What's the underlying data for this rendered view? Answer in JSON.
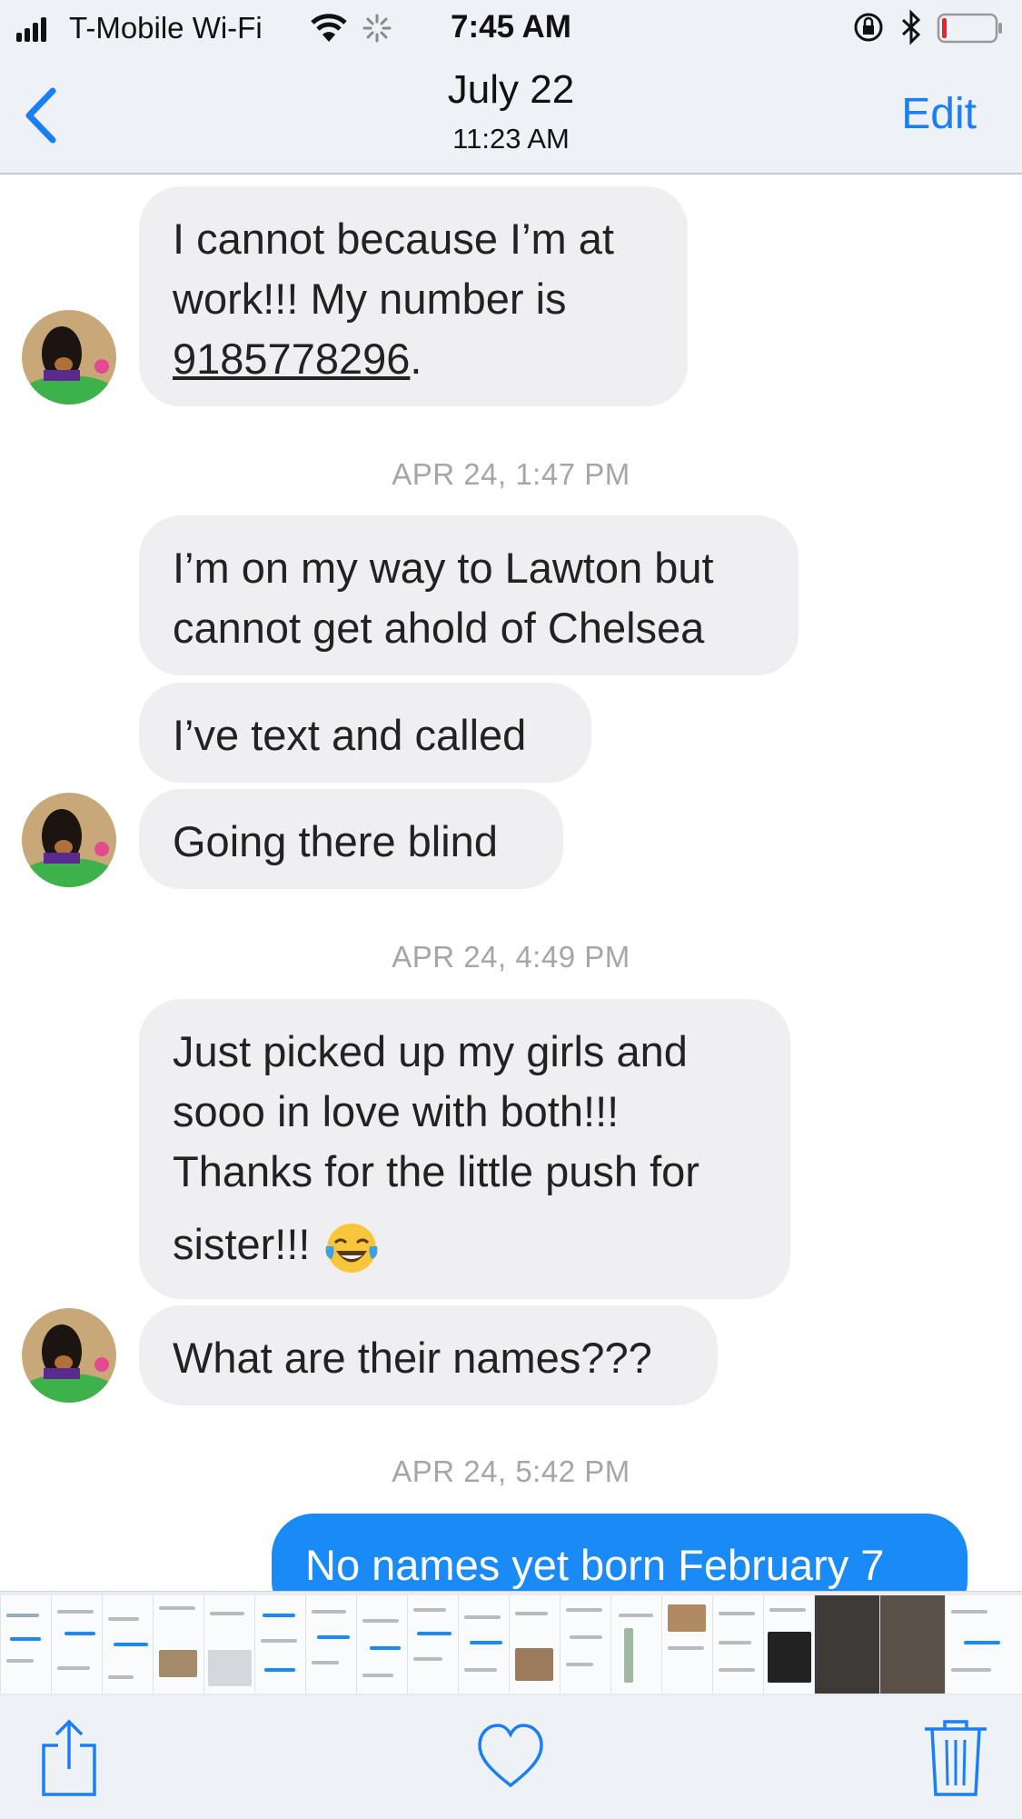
{
  "status_bar": {
    "carrier": "T-Mobile Wi-Fi",
    "time": "7:45 AM",
    "icons": [
      "signal-icon",
      "wifi-icon",
      "activity-spinner-icon",
      "orientation-lock-icon",
      "bluetooth-icon",
      "battery-low-icon"
    ]
  },
  "nav": {
    "back_icon": "chevron-left-icon",
    "date": "July 22",
    "time": "11:23 AM",
    "edit_label": "Edit"
  },
  "messages": {
    "m1_line1": "I cannot because I’m at",
    "m1_line2": "work!!! My number is",
    "m1_phone": "9185778296",
    "m1_end": ".",
    "ts1": "APR 24, 1:47 PM",
    "m2_line1": "I’m on my way to Lawton but",
    "m2_line2": "cannot get ahold of Chelsea",
    "m3": "I’ve text and called",
    "m4": "Going there blind",
    "ts2": "APR 24, 4:49 PM",
    "m5_line1": "Just picked up my girls and",
    "m5_line2": "sooo in love with both!!!",
    "m5_line3": "Thanks for the little push for",
    "m5_line4": "sister!!!",
    "m5_emoji": "face-with-tears-of-joy-icon",
    "m6": "What are their names???",
    "ts3": "APR 24, 5:42 PM",
    "m7": "No names yet born February 7"
  },
  "colors": {
    "accent": "#1a7ef5",
    "received_bubble": "#efeff1",
    "sent_bubble": "#1a8bf6",
    "timestamp": "#a5a5aa"
  },
  "toolbar": {
    "icons": [
      "share-icon",
      "heart-icon",
      "trash-icon"
    ]
  }
}
